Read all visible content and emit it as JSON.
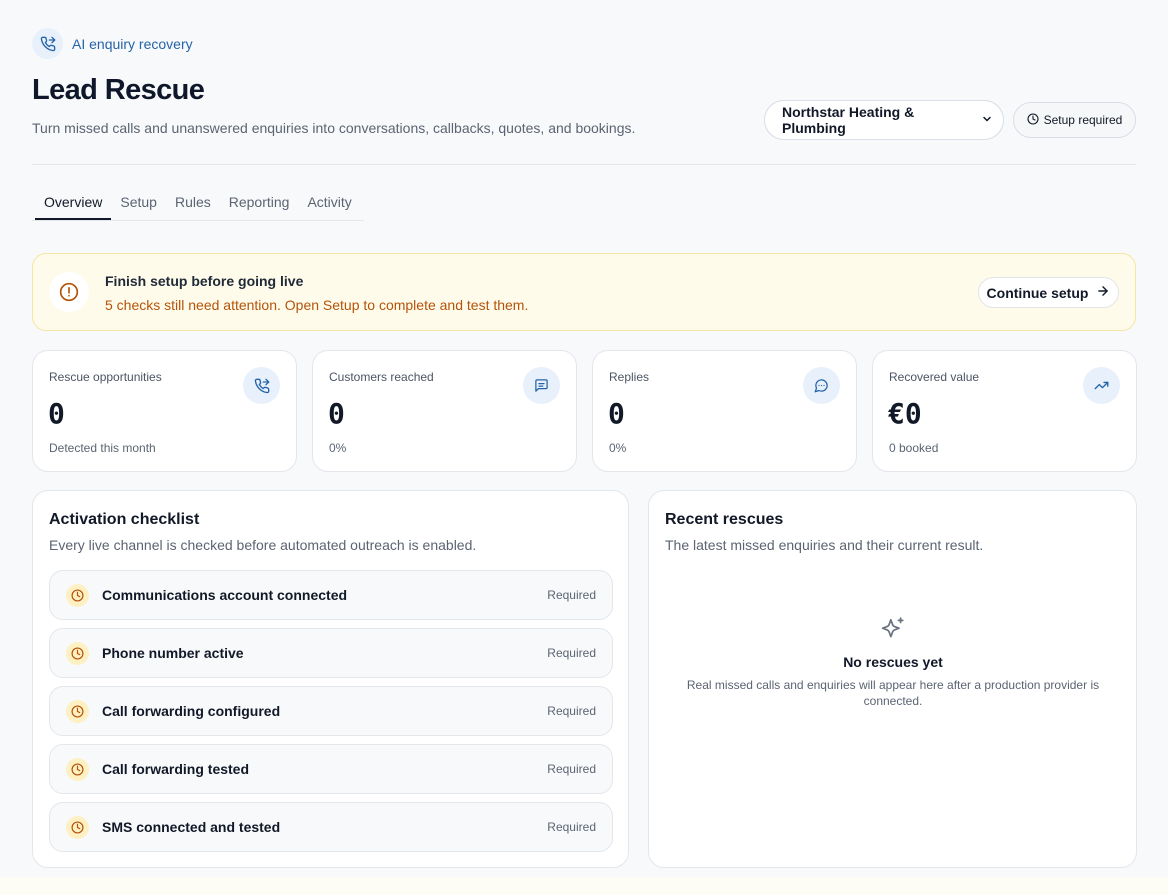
{
  "header": {
    "eyebrow": "AI enquiry recovery",
    "title": "Lead Rescue",
    "subtitle": "Turn missed calls and unanswered enquiries into conversations, callbacks, quotes, and bookings.",
    "business_select": "Northstar Heating & Plumbing",
    "status_badge": "Setup required"
  },
  "tabs": [
    "Overview",
    "Setup",
    "Rules",
    "Reporting",
    "Activity"
  ],
  "active_tab": "Overview",
  "alert": {
    "title": "Finish setup before going live",
    "text": "5 checks still need attention. Open Setup to complete and test them.",
    "button": "Continue setup"
  },
  "stats": [
    {
      "label": "Rescue opportunities",
      "value": "0",
      "sub": "Detected this month",
      "icon": "phone-forward-icon"
    },
    {
      "label": "Customers reached",
      "value": "0",
      "sub": "0%",
      "icon": "message-square-icon"
    },
    {
      "label": "Replies",
      "value": "0",
      "sub": "0%",
      "icon": "message-circle-icon"
    },
    {
      "label": "Recovered value",
      "value": "€0",
      "sub": "0 booked",
      "icon": "trending-up-icon"
    }
  ],
  "checklist": {
    "title": "Activation checklist",
    "subtitle": "Every live channel is checked before automated outreach is enabled.",
    "items": [
      {
        "label": "Communications account connected",
        "status": "Required"
      },
      {
        "label": "Phone number active",
        "status": "Required"
      },
      {
        "label": "Call forwarding configured",
        "status": "Required"
      },
      {
        "label": "Call forwarding tested",
        "status": "Required"
      },
      {
        "label": "SMS connected and tested",
        "status": "Required"
      }
    ]
  },
  "recent": {
    "title": "Recent rescues",
    "subtitle": "The latest missed enquiries and their current result.",
    "empty_title": "No rescues yet",
    "empty_text": "Real missed calls and enquiries will appear here after a production provider is connected."
  },
  "colors": {
    "accent_blue": "#2563a8",
    "warning_bg": "#fffbeb",
    "warning_text": "#b45309",
    "pending_icon_bg": "#fdf0c3"
  }
}
